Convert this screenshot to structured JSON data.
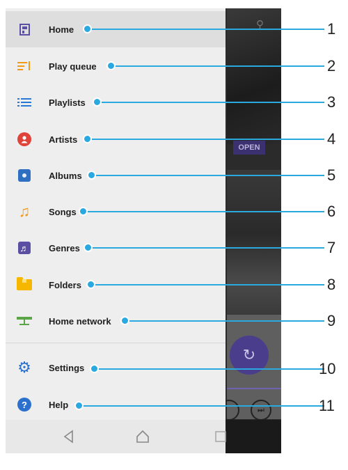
{
  "menu": {
    "items": [
      {
        "label": "Home",
        "icon": "home-icon"
      },
      {
        "label": "Play queue",
        "icon": "play-queue-icon"
      },
      {
        "label": "Playlists",
        "icon": "playlists-icon"
      },
      {
        "label": "Artists",
        "icon": "artist-icon"
      },
      {
        "label": "Albums",
        "icon": "album-icon"
      },
      {
        "label": "Songs",
        "icon": "music-note-icon"
      },
      {
        "label": "Genres",
        "icon": "guitar-icon"
      },
      {
        "label": "Folders",
        "icon": "folder-icon"
      },
      {
        "label": "Home network",
        "icon": "network-icon"
      },
      {
        "label": "Settings",
        "icon": "gear-icon"
      },
      {
        "label": "Help",
        "icon": "help-icon"
      }
    ]
  },
  "background": {
    "open_label": "OPEN"
  },
  "callouts": [
    "1",
    "2",
    "3",
    "4",
    "5",
    "6",
    "7",
    "8",
    "9",
    "10",
    "11"
  ],
  "colors": {
    "accent": "#2aa8e0",
    "purple": "#5a4fa3",
    "orange": "#f29a16",
    "blue": "#2a78d6",
    "red": "#e0433a"
  }
}
